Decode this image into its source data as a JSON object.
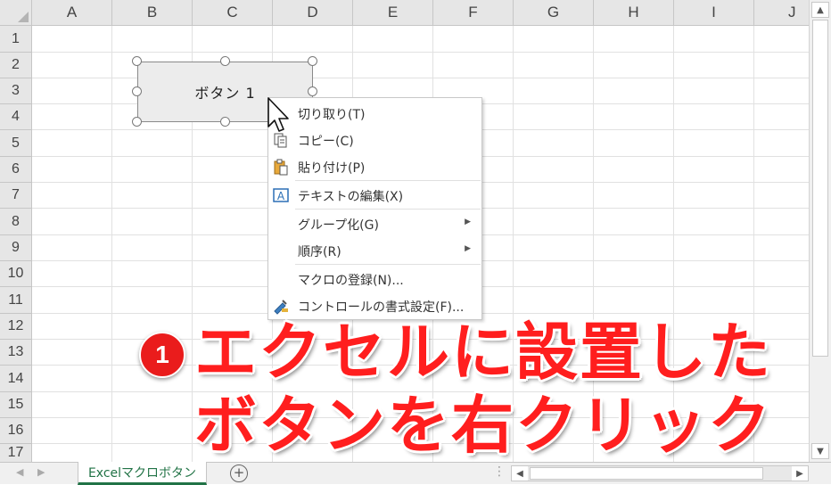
{
  "columns": [
    "A",
    "B",
    "C",
    "D",
    "E",
    "F",
    "G",
    "H",
    "I",
    "J"
  ],
  "rows": [
    "1",
    "2",
    "3",
    "4",
    "5",
    "6",
    "7",
    "8",
    "9",
    "10",
    "11",
    "12",
    "13",
    "14",
    "15",
    "16",
    "17"
  ],
  "form_button": {
    "label": "ボタン 1"
  },
  "context_menu": {
    "items": [
      {
        "label": "切り取り(T)",
        "icon": "scissors-icon"
      },
      {
        "label": "コピー(C)",
        "icon": "copy-icon"
      },
      {
        "label": "貼り付け(P)",
        "icon": "paste-icon"
      },
      {
        "label": "テキストの編集(X)",
        "icon": "text-edit-icon"
      },
      {
        "label": "グループ化(G)",
        "submenu": true
      },
      {
        "label": "順序(R)",
        "submenu": true
      },
      {
        "label": "マクロの登録(N)..."
      },
      {
        "label": "コントロールの書式設定(F)...",
        "icon": "format-control-icon"
      }
    ]
  },
  "sheet_tab": {
    "label": "Excelマクロボタン"
  },
  "annotation": {
    "badge": "1",
    "line1": "エクセルに設置した",
    "line2": "ボタンを右クリック",
    "color": "#ff1e1e"
  },
  "colors": {
    "accent": "#217346",
    "badge": "#ea1c1c"
  }
}
